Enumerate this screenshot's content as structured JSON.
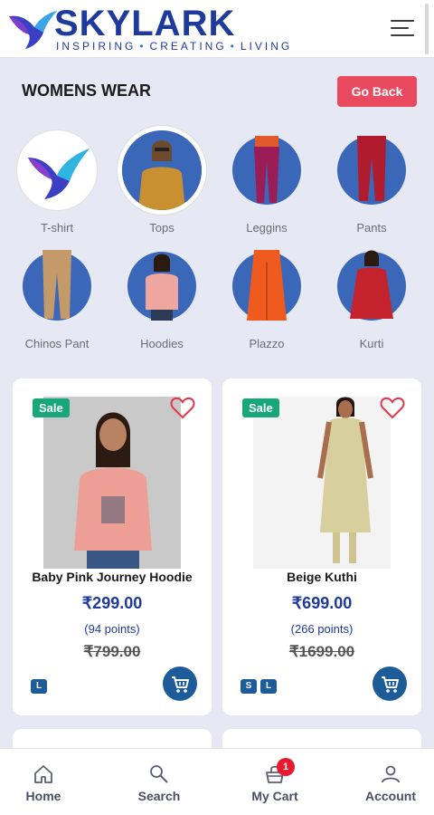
{
  "header": {
    "brand": "SKYLARK",
    "tagline": [
      "INSPIRING",
      "CREATING",
      "LIVING"
    ],
    "logo_icon": "bird-logo-icon",
    "menu_icon": "hamburger-menu-icon"
  },
  "page": {
    "title": "WOMENS WEAR",
    "back_label": "Go Back"
  },
  "categories": [
    {
      "label": "T-shirt"
    },
    {
      "label": "Tops"
    },
    {
      "label": "Leggins"
    },
    {
      "label": "Pants"
    },
    {
      "label": "Chinos Pant"
    },
    {
      "label": "Hoodies"
    },
    {
      "label": "Plazzo"
    },
    {
      "label": "Kurti"
    }
  ],
  "products": [
    {
      "badge": "Sale",
      "name": "Baby Pink Journey Hoodie",
      "price": "₹299.00",
      "points": "(94 points)",
      "mrp": "₹799.00",
      "sizes": [
        "L"
      ]
    },
    {
      "badge": "Sale",
      "name": "Beige Kuthi",
      "price": "₹699.00",
      "points": "(266 points)",
      "mrp": "₹1699.00",
      "sizes": [
        "S",
        "L"
      ]
    }
  ],
  "nav": {
    "home": "Home",
    "search": "Search",
    "cart": "My Cart",
    "cart_count": "1",
    "account": "Account"
  },
  "colors": {
    "brand": "#1e3a9c",
    "accent_red": "#ea4a5f",
    "sale_green": "#19a679",
    "cart_blue": "#1d5c99",
    "background": "#e6e9f4"
  }
}
